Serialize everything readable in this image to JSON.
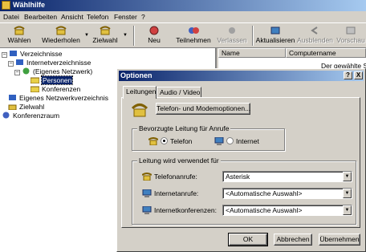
{
  "window": {
    "title": "Wählhilfe"
  },
  "menu": [
    "Datei",
    "Bearbeiten",
    "Ansicht",
    "Telefon",
    "Fenster",
    "?"
  ],
  "toolbar": {
    "waehlen": "Wählen",
    "wiederholen": "Wiederholen",
    "zielwahl": "Zielwahl",
    "neu": "Neu",
    "teilnehmen": "Teilnehmen",
    "verlassen": "Verlassen",
    "aktualisieren": "Aktualisieren",
    "ausblenden": "Ausblenden",
    "vorschau": "Vorschau"
  },
  "tree": {
    "verzeichnisse": "Verzeichnisse",
    "internetverzeichnisse": "Internetverzeichnisse",
    "eigenes_netzwerk": "(Eigenes Netzwerk)",
    "personen": "Personen",
    "konferenzen": "Konferenzen",
    "eigenes_netzwerkverzeichnis": "Eigenes Netzwerkverzeichnis",
    "zielwahl": "Zielwahl",
    "konferenzraum": "Konferenzraum"
  },
  "list": {
    "col_name": "Name",
    "col_computer": "Computername",
    "message": "Der gewählte Se"
  },
  "dialog": {
    "title": "Optionen",
    "help_btn": "?",
    "close_btn": "X",
    "tabs": [
      "Leitungen",
      "Audio / Video"
    ],
    "modem_button": "Telefon- und Modemoptionen...",
    "preferred_group": "Bevorzugte Leitung für Anrufe",
    "radio_telefon": "Telefon",
    "radio_internet": "Internet",
    "line_group": "Leitung wird verwendet für",
    "rows": [
      {
        "label": "Telefonanrufe:",
        "value": "Asterisk"
      },
      {
        "label": "Internetanrufe:",
        "value": "<Automatische Auswahl>"
      },
      {
        "label": "Internetkonferenzen:",
        "value": "<Automatische Auswahl>"
      }
    ],
    "ok": "OK",
    "cancel": "Abbrechen",
    "apply": "Übernehmen"
  },
  "colors": {
    "titlebar_start": "#0a246a",
    "titlebar_end": "#a6caf0",
    "face": "#d4d0c8"
  }
}
